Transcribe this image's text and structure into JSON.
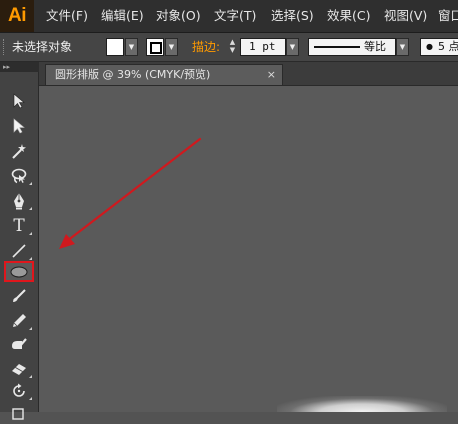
{
  "app": {
    "logo": "Ai",
    "menu": [
      "文件(F)",
      "编辑(E)",
      "对象(O)",
      "文字(T)",
      "选择(S)",
      "效果(C)",
      "视图(V)",
      "窗口"
    ]
  },
  "control_bar": {
    "selection_label": "未选择对象",
    "fill_color": "#ffffff",
    "stroke_label": "描边:",
    "stroke_weight": "1 pt",
    "profile_label": "等比",
    "brush_size": "5 点"
  },
  "document": {
    "tab_title": "圆形排版 @ 39% (CMYK/预览)",
    "close_glyph": "×"
  },
  "toolbar": {
    "collapse_glyph": "▸▸",
    "tools": [
      {
        "name": "selection-tool",
        "icon": "black-arrow-icon",
        "active": false
      },
      {
        "name": "direct-selection-tool",
        "icon": "white-arrow-icon",
        "active": false
      },
      {
        "name": "magic-wand-tool",
        "icon": "magic-wand-icon",
        "active": false
      },
      {
        "name": "lasso-tool",
        "icon": "lasso-icon",
        "active": false
      },
      {
        "name": "pen-tool",
        "icon": "pen-icon",
        "active": false
      },
      {
        "name": "type-tool",
        "icon": "type-icon",
        "active": false,
        "glyph": "T"
      },
      {
        "name": "line-segment-tool",
        "icon": "line-icon",
        "active": false
      },
      {
        "name": "ellipse-tool",
        "icon": "ellipse-icon",
        "active": true
      },
      {
        "name": "paintbrush-tool",
        "icon": "paintbrush-icon",
        "active": false
      },
      {
        "name": "pencil-tool",
        "icon": "pencil-icon",
        "active": false
      },
      {
        "name": "blob-brush-tool",
        "icon": "blob-brush-icon",
        "active": false
      },
      {
        "name": "eraser-tool",
        "icon": "eraser-icon",
        "active": false
      },
      {
        "name": "rotate-tool",
        "icon": "rotate-icon",
        "active": false
      },
      {
        "name": "scale-tool",
        "icon": "scale-icon",
        "active": false
      }
    ]
  },
  "colors": {
    "app_accent": "#ff9a00",
    "highlight": "#e0161c",
    "annotation_arrow": "#d0191e"
  }
}
